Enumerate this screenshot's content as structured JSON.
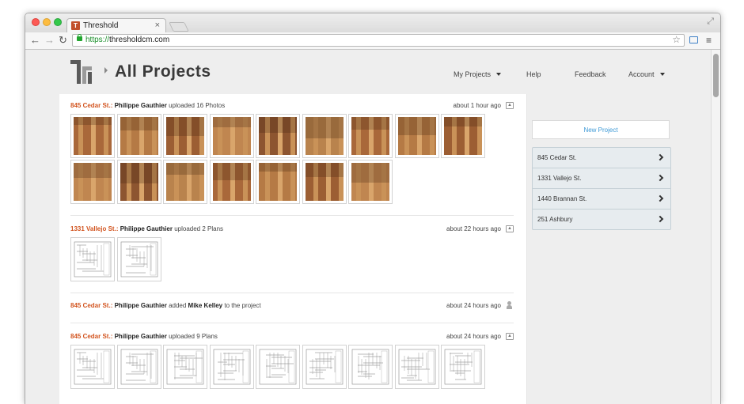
{
  "browser": {
    "tab_title": "Threshold",
    "favicon_letter": "T",
    "tab_close": "×",
    "url_scheme": "https://",
    "url_host": "thresholdcm.com",
    "back": "←",
    "forward": "→",
    "reload": "↻",
    "star": "☆",
    "menu": "≡",
    "resize": "⤢"
  },
  "header": {
    "title": "All Projects",
    "nav": [
      {
        "label": "My Projects",
        "dropdown": true
      },
      {
        "label": "Help",
        "dropdown": false
      },
      {
        "label": "Feedback",
        "dropdown": false
      },
      {
        "label": "Account",
        "dropdown": true
      }
    ]
  },
  "feed": [
    {
      "project": "845 Cedar St.:",
      "user": "Philippe Gauthier",
      "action": "uploaded 16 Photos",
      "time": "about 1 hour ago",
      "icon": "upload-icon",
      "kind": "photos",
      "count": 16
    },
    {
      "project": "1331 Vallejo St.:",
      "user": "Philippe Gauthier",
      "action": "uploaded 2 Plans",
      "time": "about 22 hours ago",
      "icon": "upload-icon",
      "kind": "plans",
      "count": 2
    },
    {
      "project": "845 Cedar St.:",
      "user": "Philippe Gauthier",
      "action": "added",
      "target": "Mike Kelley",
      "action_suffix": "to the project",
      "time": "about 24 hours ago",
      "icon": "person-icon",
      "kind": "member",
      "count": 0
    },
    {
      "project": "845 Cedar St.:",
      "user": "Philippe Gauthier",
      "action": "uploaded 9 Plans",
      "time": "about 24 hours ago",
      "icon": "upload-icon",
      "kind": "plans",
      "count": 9
    }
  ],
  "sidebar": {
    "new_project": "New Project",
    "projects": [
      "845 Cedar St.",
      "1331 Vallejo St.",
      "1440 Brannan St.",
      "251 Ashbury"
    ]
  },
  "colors": {
    "accent_orange": "#d2541f",
    "link_blue": "#3d99d6"
  }
}
